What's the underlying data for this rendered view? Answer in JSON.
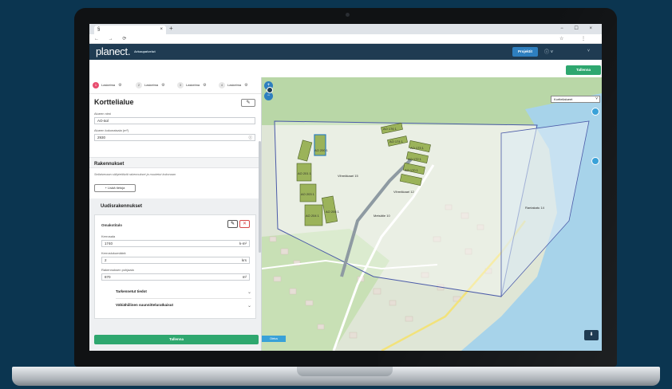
{
  "browser": {
    "tab_title": "§",
    "new_tab": "+",
    "window_controls": "− ☐ ×",
    "nav": "← → ⟳",
    "url": "",
    "addr_right": "☆ ⋮"
  },
  "app": {
    "logo": "planect.",
    "brand": "Arkoupalvelut",
    "projects_label": "Projektit",
    "help_label": "ⓘ ˅",
    "menu_label": "˅",
    "save_top_label": "Tallenna"
  },
  "left_panel": {
    "tabs": [
      {
        "num": "1",
        "label": "Laskelma",
        "active": true
      },
      {
        "num": "2",
        "label": "Laskelma",
        "active": false
      },
      {
        "num": "3",
        "label": "Laskelma",
        "active": false
      },
      {
        "num": "4",
        "label": "Laskelma",
        "active": false
      }
    ],
    "gear_glyph": "⚙",
    "title": "Korttelialue",
    "edit_glyph": "✎",
    "area_name_label": "Alueen nimi",
    "area_name_value": "AO-äol",
    "area_size_label": "Alueen kokonaisala (m²)",
    "area_size_value": "2930",
    "info_glyph": "ⓘ",
    "buildings_title": "Rakennukset",
    "buildings_note": "Sellaisenaan säilytettävät rakennukset ja muutetut kokonaan",
    "add_info_label": "+ Lisää tietoja",
    "new_buildings_title": "Uudisrakennukset",
    "card": {
      "title": "Omakotitalo",
      "edit_glyph": "✎",
      "delete_glyph": "✕",
      "fields": [
        {
          "label": "Kerrosala",
          "value": "1740",
          "unit": "k-m²"
        },
        {
          "label": "Kerroslukumäärä",
          "value": "2",
          "unit": "krs"
        },
        {
          "label": "Rakennuksen pohjaala",
          "value": "870",
          "unit": "m²"
        }
      ],
      "accordions": [
        {
          "label": "Tarkennetut tiedot",
          "chev": "⌄"
        },
        {
          "label": "Vähiähiilinen suunnitteluratkaisut",
          "chev": "⌄"
        }
      ]
    },
    "save_bottom_label": "Tallenna"
  },
  "map": {
    "zoom_in": "+",
    "zoom_out": "−",
    "layer_select": "Korttelialueet",
    "layer_chev": "˅",
    "fab_glyph": "⬇",
    "badge_label": "Oletus",
    "parcel_labels": [
      "AO 200 1",
      "AO 201 1",
      "AO 203 1",
      "AO 204 1",
      "AO 205 1",
      "AO 176 1",
      "AO 174 1",
      "AO 173 1",
      "AO 172 1",
      "AO 170 1",
      "Vihreäkaari 15",
      "Vihreäkaari 12",
      "Metsätie 10",
      "Rantakatu 14"
    ]
  },
  "colors": {
    "header": "#1f3b52",
    "accent_green": "#2ea76f",
    "accent_blue": "#2e7fbf",
    "active_tab": "#e84d6f",
    "parcel_fill": "#9bb35a",
    "water": "#a7d3ea"
  }
}
